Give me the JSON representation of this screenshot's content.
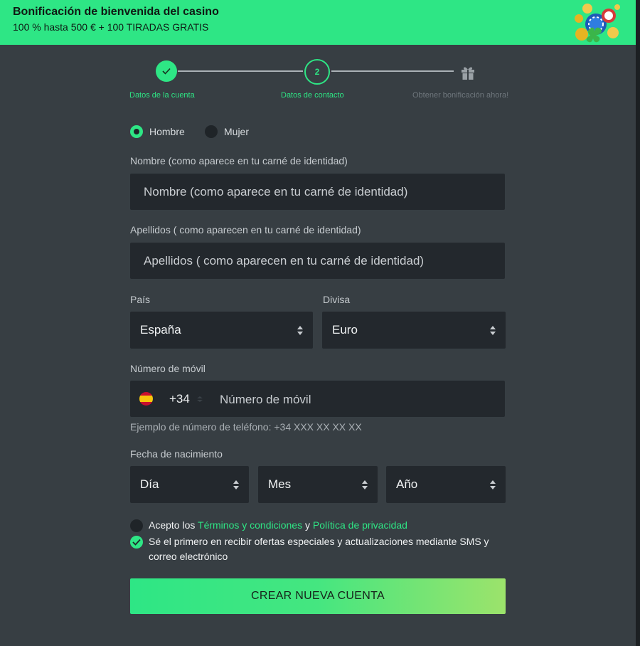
{
  "banner": {
    "title": "Bonificación de bienvenida del casino",
    "subtitle": "100 % hasta 500 € + 100 TIRADAS GRATIS",
    "art_icon": "chips-coins-clover-icon"
  },
  "stepper": {
    "steps": [
      {
        "label": "Datos de la cuenta",
        "state": "completed",
        "icon": "check-icon"
      },
      {
        "label": "Datos de contacto",
        "state": "active",
        "number": "2"
      },
      {
        "label": "Obtener bonificación ahora!",
        "state": "pending",
        "icon": "gift-icon"
      }
    ]
  },
  "form": {
    "gender": {
      "male": "Hombre",
      "female": "Mujer",
      "selected": "Hombre"
    },
    "first_name": {
      "label": "Nombre (como aparece en tu carné de identidad)",
      "placeholder": "Nombre (como aparece en tu carné de identidad)",
      "value": ""
    },
    "last_name": {
      "label": "Apellidos ( como aparecen en tu carné de identidad)",
      "placeholder": "Apellidos ( como aparecen en tu carné de identidad)",
      "value": ""
    },
    "country": {
      "label": "País",
      "value": "España"
    },
    "currency": {
      "label": "Divisa",
      "value": "Euro"
    },
    "phone": {
      "label": "Número de móvil",
      "dial_code": "+34",
      "flag": "spain-flag-icon",
      "placeholder": "Número de móvil",
      "hint": "Ejemplo de número de teléfono: +34 XXX XX XX XX"
    },
    "birthdate": {
      "label": "Fecha de nacimiento",
      "day": "Día",
      "month": "Mes",
      "year": "Año"
    },
    "terms": {
      "prefix": "Acepto los",
      "terms_link": "Términos y condiciones",
      "joiner": "y",
      "privacy_link": "Política de privacidad",
      "checked": false
    },
    "marketing": {
      "text": "Sé el primero en recibir ofertas especiales y actualizaciones mediante SMS y correo electrónico",
      "checked": true
    },
    "submit_label": "CREAR NUEVA CUENTA"
  },
  "colors": {
    "accent": "#2ee685",
    "background": "#373e43",
    "field": "#23282d",
    "muted_text": "#6f777d"
  }
}
